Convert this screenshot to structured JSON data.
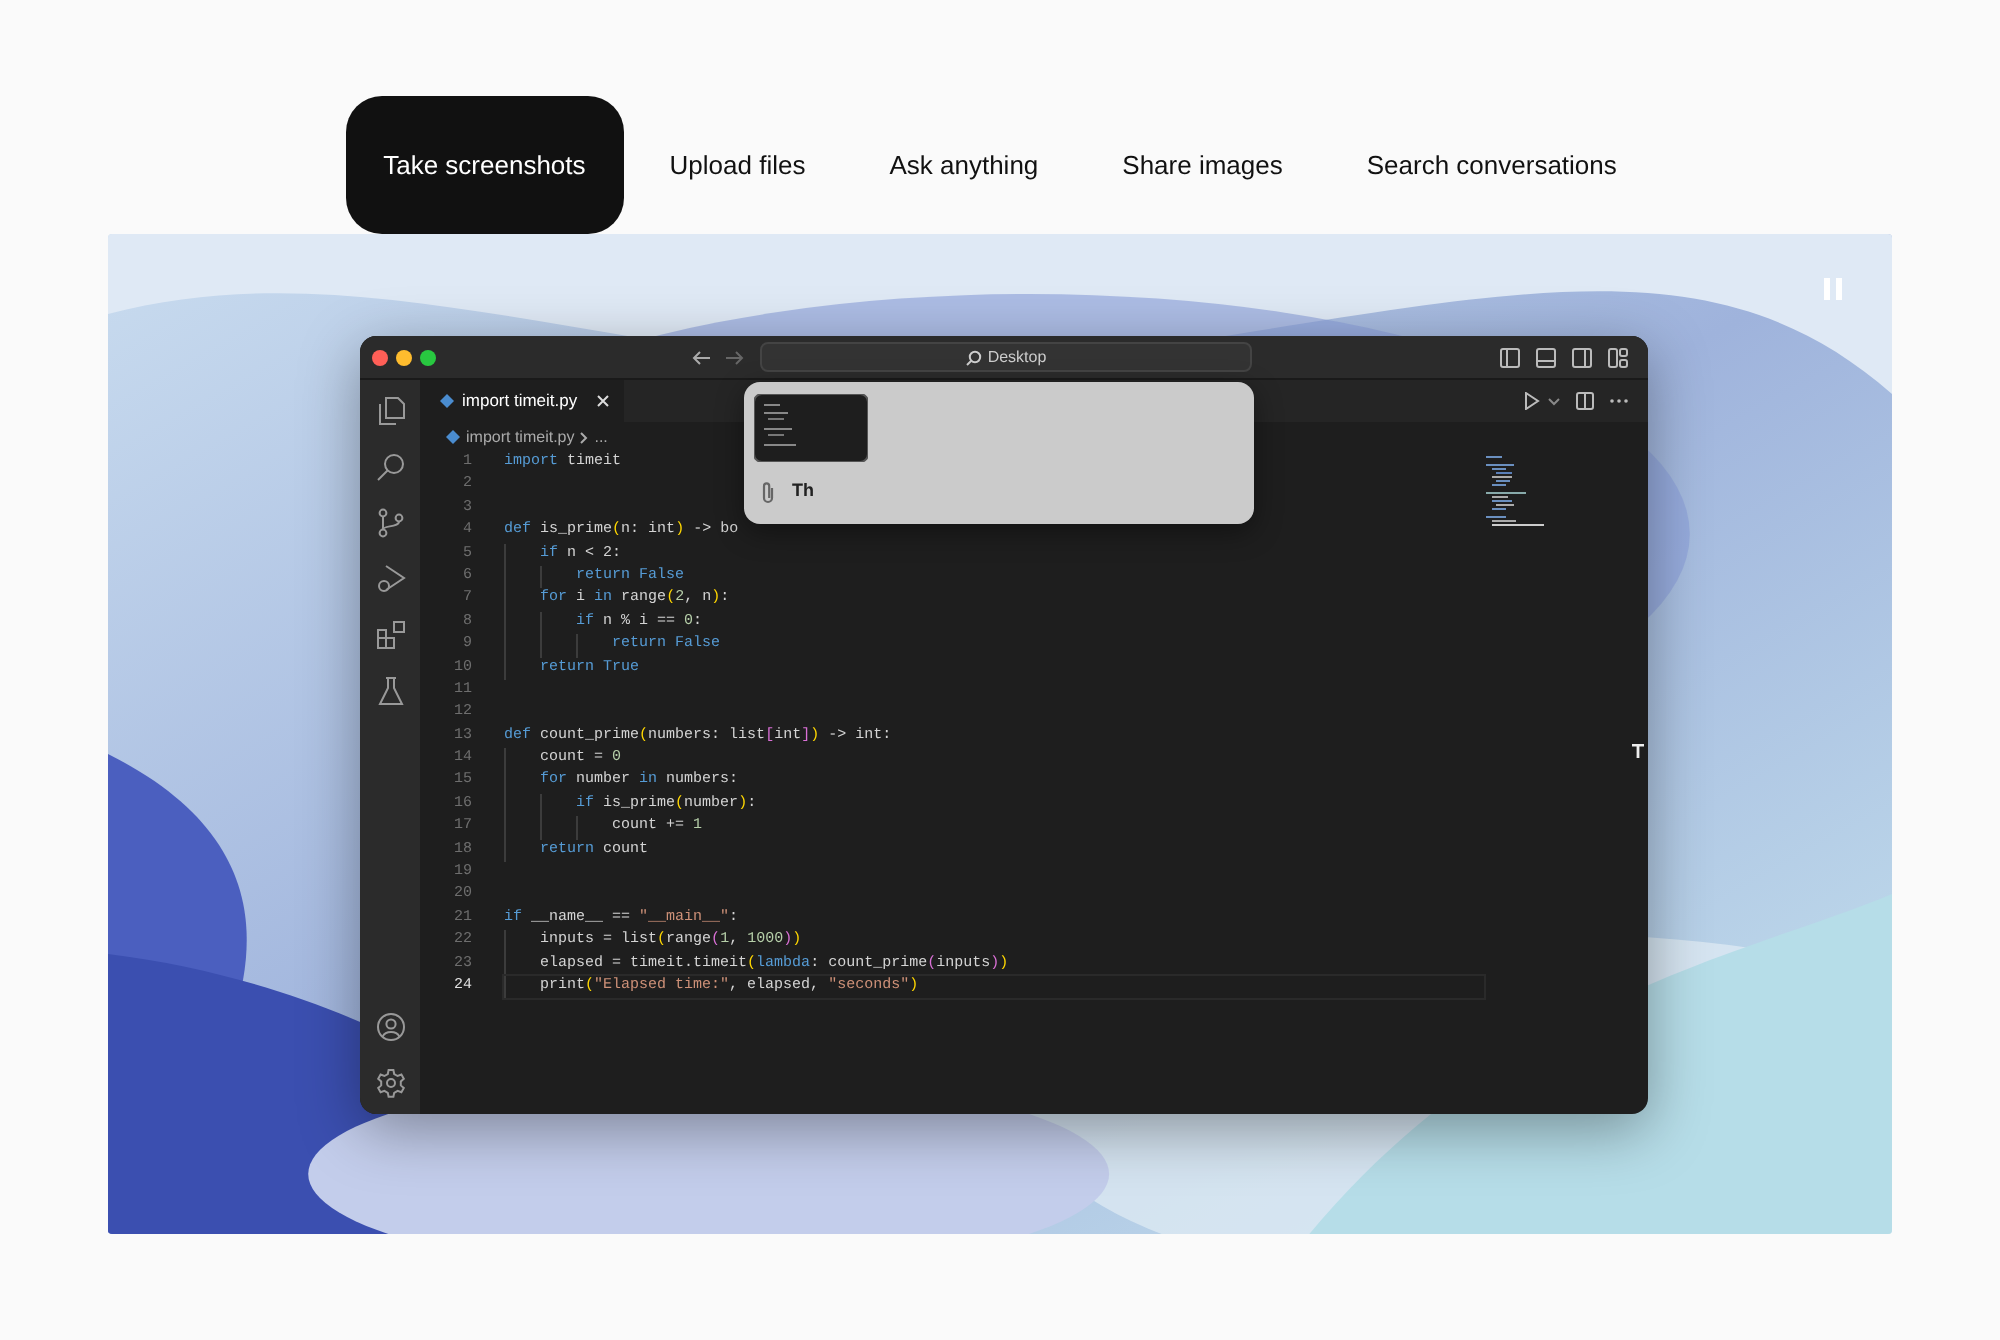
{
  "nav_tabs": [
    {
      "label": "Take screenshots",
      "selected": true
    },
    {
      "label": "Upload files",
      "selected": false
    },
    {
      "label": "Ask anything",
      "selected": false
    },
    {
      "label": "Share images",
      "selected": false
    },
    {
      "label": "Search conversations",
      "selected": false
    }
  ],
  "editor": {
    "title_search": "Desktop",
    "tab": {
      "label": "import timeit.py",
      "selected": true
    },
    "breadcrumb": [
      "import timeit.py",
      "..."
    ],
    "lines": [
      {
        "number": "1",
        "current": false,
        "code": [
          {
            "kw": "import"
          },
          {
            "p": " timeit"
          }
        ]
      },
      {
        "number": "2",
        "current": false
      },
      {
        "number": "3",
        "current": false
      },
      {
        "number": "4",
        "current": false,
        "code": [
          {
            "kw": "def"
          },
          {
            "p": " is_prime"
          },
          {
            "b1": "("
          },
          {
            "p": "n: int"
          },
          {
            "b1": ")"
          },
          {
            "p": " -> bo"
          }
        ]
      },
      {
        "number": "5",
        "current": false,
        "code": [
          {
            "kw": "    if"
          },
          {
            "p": " n < 2:"
          }
        ]
      },
      {
        "number": "6",
        "current": false,
        "code": [
          {
            "kw": "        return False"
          }
        ]
      },
      {
        "number": "7",
        "current": false,
        "code": [
          {
            "kw": "    for"
          },
          {
            "p": " i "
          },
          {
            "kw": "in"
          },
          {
            "p": " range"
          },
          {
            "b1": "("
          },
          {
            "num": "2"
          },
          {
            "p": ", n"
          },
          {
            "b1": ")"
          },
          {
            "p": ":"
          }
        ]
      },
      {
        "number": "8",
        "current": false,
        "code": [
          {
            "kw": "        if"
          },
          {
            "p": " n % i == "
          },
          {
            "num": "0"
          },
          {
            "p": ":"
          }
        ]
      },
      {
        "number": "9",
        "current": false,
        "code": [
          {
            "kw": "            return False"
          }
        ]
      },
      {
        "number": "10",
        "current": false,
        "code": [
          {
            "kw": "    return True"
          }
        ]
      },
      {
        "number": "11",
        "current": false
      },
      {
        "number": "12",
        "current": false
      },
      {
        "number": "13",
        "current": false,
        "code": [
          {
            "kw": "def"
          },
          {
            "p": " count_prime"
          },
          {
            "b1": "("
          },
          {
            "p": "numbers: list"
          },
          {
            "b2": "["
          },
          {
            "p": "int"
          },
          {
            "b2": "]"
          },
          {
            "b1": ")"
          },
          {
            "p": " -> int:"
          }
        ]
      },
      {
        "number": "14",
        "current": false,
        "code": [
          {
            "p": "    count = "
          },
          {
            "num": "0"
          }
        ]
      },
      {
        "number": "15",
        "current": false,
        "code": [
          {
            "kw": "    for"
          },
          {
            "p": " number "
          },
          {
            "kw": "in"
          },
          {
            "p": " numbers:"
          }
        ]
      },
      {
        "number": "16",
        "current": false,
        "code": [
          {
            "kw": "        if"
          },
          {
            "p": " is_prime"
          },
          {
            "b1": "("
          },
          {
            "p": "number"
          },
          {
            "b1": ")"
          },
          {
            "p": ":"
          }
        ]
      },
      {
        "number": "17",
        "current": false,
        "code": [
          {
            "p": "            count += "
          },
          {
            "num": "1"
          }
        ]
      },
      {
        "number": "18",
        "current": false,
        "code": [
          {
            "kw": "    return"
          },
          {
            "p": " count"
          }
        ]
      },
      {
        "number": "19",
        "current": false
      },
      {
        "number": "20",
        "current": false
      },
      {
        "number": "21",
        "current": false,
        "code": [
          {
            "kw": "if"
          },
          {
            "p": " __name__ == "
          },
          {
            "str": "\"__main__\""
          },
          {
            "p": ":"
          }
        ]
      },
      {
        "number": "22",
        "current": false,
        "code": [
          {
            "p": "    inputs = list"
          },
          {
            "b1": "("
          },
          {
            "p": "range"
          },
          {
            "b2": "("
          },
          {
            "num": "1"
          },
          {
            "p": ", "
          },
          {
            "num": "1000"
          },
          {
            "b2": ")"
          },
          {
            "b1": ")"
          }
        ]
      },
      {
        "number": "23",
        "current": false,
        "code": [
          {
            "p": "    elapsed = timeit.timeit"
          },
          {
            "b1": "("
          },
          {
            "kw": "lambda"
          },
          {
            "p": ": count_prime"
          },
          {
            "b2": "("
          },
          {
            "p": "inputs"
          },
          {
            "b2": ")"
          },
          {
            "b1": ")"
          }
        ]
      },
      {
        "number": "24",
        "current": true,
        "code": [
          {
            "p": "    print"
          },
          {
            "b1": "("
          },
          {
            "str": "\"Elapsed time:\""
          },
          {
            "p": ", elapsed, "
          },
          {
            "str": "\"seconds\""
          },
          {
            "b1": ")"
          }
        ]
      }
    ]
  },
  "popup": {
    "input_value": "Th"
  }
}
